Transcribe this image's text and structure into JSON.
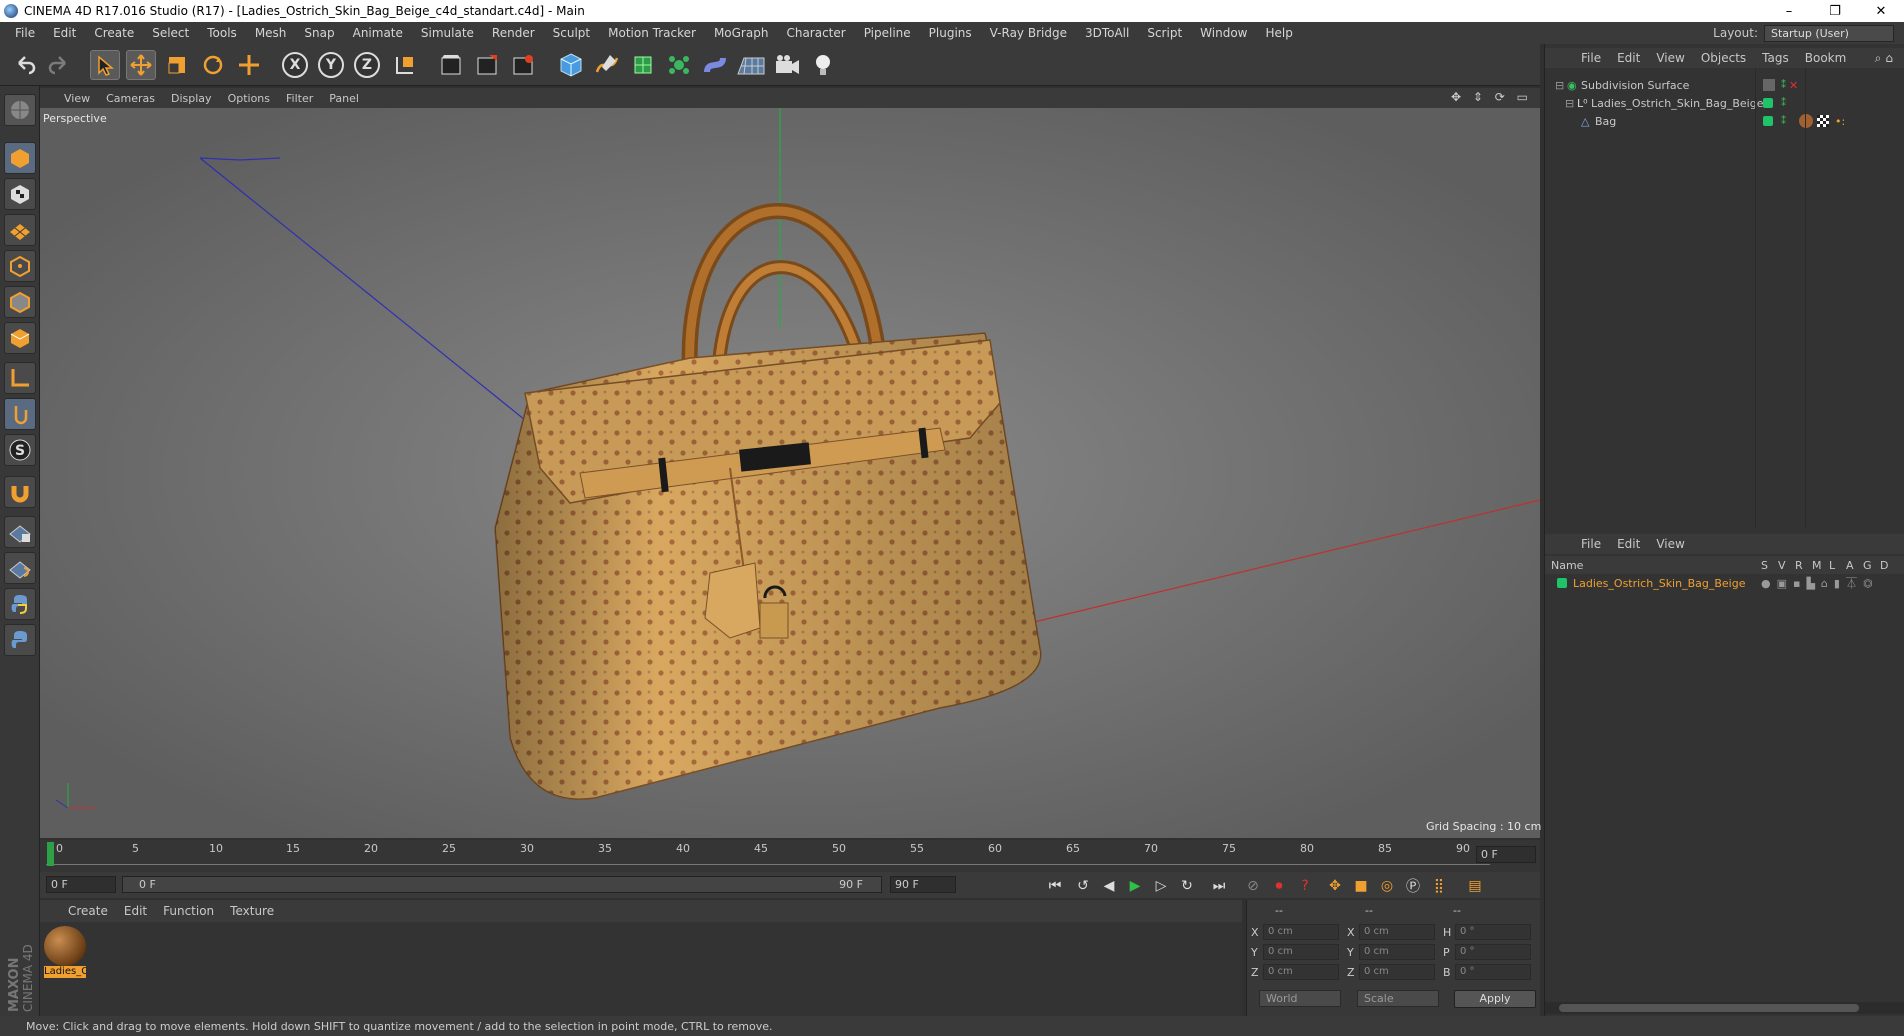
{
  "window": {
    "title": "CINEMA 4D R17.016 Studio (R17) - [Ladies_Ostrich_Skin_Bag_Beige_c4d_standart.c4d] - Main",
    "minimize": "–",
    "restore": "❐",
    "close": "✕"
  },
  "menubar": {
    "items": [
      "File",
      "Edit",
      "Create",
      "Select",
      "Tools",
      "Mesh",
      "Snap",
      "Animate",
      "Simulate",
      "Render",
      "Sculpt",
      "Motion Tracker",
      "MoGraph",
      "Character",
      "Pipeline",
      "Plugins",
      "V-Ray Bridge",
      "3DToAll",
      "Script",
      "Window",
      "Help"
    ],
    "layout_label": "Layout:",
    "layout_value": "Startup (User)"
  },
  "toolbar": {
    "icons": [
      "undo-icon",
      "redo-icon",
      "select-arrow-icon",
      "move-icon",
      "scale-icon",
      "rotate-icon",
      "move-multi-icon",
      "x-axis-icon",
      "y-axis-icon",
      "z-axis-icon",
      "world-coords-icon",
      "render-view-icon",
      "render-picture-icon",
      "render-settings-icon",
      "cube-icon",
      "spline-pen-icon",
      "subdivision-icon",
      "mograph-cloner-icon",
      "deformer-icon",
      "floor-icon",
      "camera-icon",
      "light-icon"
    ],
    "axis_x": "X",
    "axis_y": "Y",
    "axis_z": "Z"
  },
  "viewport": {
    "menu": [
      "View",
      "Cameras",
      "Display",
      "Options",
      "Filter",
      "Panel"
    ],
    "label": "Perspective",
    "grid_spacing": "Grid Spacing : 10 cm",
    "nav_icons": "✥ ⇕ ⟳ ▭"
  },
  "timeline": {
    "ticks": [
      "0",
      "5",
      "10",
      "15",
      "20",
      "25",
      "30",
      "35",
      "40",
      "45",
      "50",
      "55",
      "60",
      "65",
      "70",
      "75",
      "80",
      "85",
      "90"
    ],
    "current_frame": "0 F",
    "start": "0 F",
    "slider_start": "0 F",
    "slider_end": "90 F",
    "end": "90 F"
  },
  "materials": {
    "menu": [
      "Create",
      "Edit",
      "Function",
      "Texture"
    ],
    "items": [
      {
        "label": "Ladies_O"
      }
    ]
  },
  "coords": {
    "header_dashes": [
      "--",
      "--",
      "--"
    ],
    "rows": [
      {
        "axis": "X",
        "pos": "0 cm",
        "axis2": "X",
        "size": "0 cm",
        "rot_label": "H",
        "rot": "0 °"
      },
      {
        "axis": "Y",
        "pos": "0 cm",
        "axis2": "Y",
        "size": "0 cm",
        "rot_label": "P",
        "rot": "0 °"
      },
      {
        "axis": "Z",
        "pos": "0 cm",
        "axis2": "Z",
        "size": "0 cm",
        "rot_label": "B",
        "rot": "0 °"
      }
    ],
    "world": "World",
    "scale": "Scale",
    "apply": "Apply"
  },
  "objects": {
    "menu": [
      "File",
      "Edit",
      "View",
      "Objects",
      "Tags",
      "Bookm"
    ],
    "tree": [
      {
        "name": "Subdivision Surface",
        "indent": 0
      },
      {
        "name": "Ladies_Ostrich_Skin_Bag_Beige",
        "indent": 1
      },
      {
        "name": "Bag",
        "indent": 2
      }
    ]
  },
  "attributes": {
    "menu": [
      "File",
      "Edit",
      "View"
    ],
    "columns": [
      "Name",
      "S",
      "V",
      "R",
      "M",
      "L",
      "A",
      "G",
      "D"
    ],
    "row": "Ladies_Ostrich_Skin_Bag_Beige"
  },
  "status": "Move: Click and drag to move elements. Hold down SHIFT to quantize movement / add to the selection in point mode, CTRL to remove.",
  "colors": {
    "accent": "#f0a030",
    "green_tag": "#1fc46a",
    "axis_x": "#c03030",
    "axis_y": "#20b040",
    "axis_z": "#3030b0"
  },
  "brand": "MAXON CINEMA 4D"
}
